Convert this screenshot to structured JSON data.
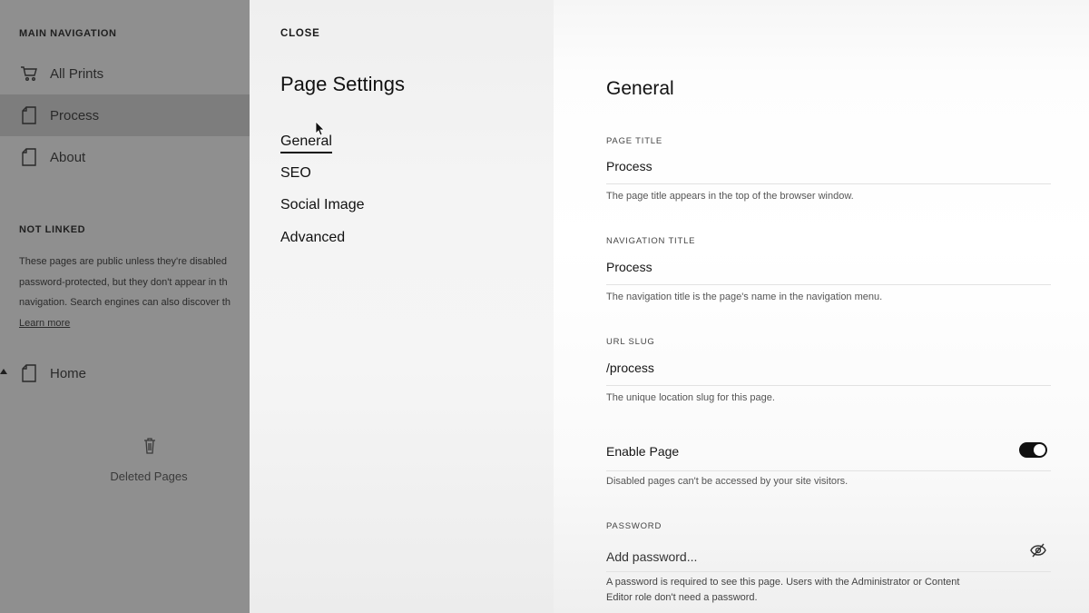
{
  "sidebar": {
    "main_nav_heading": "MAIN NAVIGATION",
    "items": [
      {
        "label": "All Prints",
        "icon": "cart-icon"
      },
      {
        "label": "Process",
        "icon": "page-icon"
      },
      {
        "label": "About",
        "icon": "page-icon"
      }
    ],
    "not_linked_heading": "NOT LINKED",
    "not_linked_note_lines": [
      "These pages are public unless they're disabled",
      "password-protected, but they don't appear in th",
      "navigation. Search engines can also discover th"
    ],
    "learn_more": "Learn more",
    "home_item": {
      "label": "Home",
      "icon": "page-icon"
    },
    "deleted_pages": "Deleted Pages"
  },
  "settings_menu": {
    "close_label": "CLOSE",
    "title": "Page Settings",
    "items": [
      "General",
      "SEO",
      "Social Image",
      "Advanced"
    ],
    "active_item": "General"
  },
  "general": {
    "title": "General",
    "page_title": {
      "label": "PAGE TITLE",
      "value": "Process",
      "help": "The page title appears in the top of the browser window."
    },
    "navigation_title": {
      "label": "NAVIGATION TITLE",
      "value": "Process",
      "help": "The navigation title is the page's name in the navigation menu."
    },
    "url_slug": {
      "label": "URL SLUG",
      "value": "/process",
      "help": "The unique location slug for this page."
    },
    "enable_page": {
      "label": "Enable Page",
      "enabled": true,
      "help": "Disabled pages can't be accessed by your site visitors."
    },
    "password": {
      "label": "PASSWORD",
      "placeholder": "Add password...",
      "help_lines": [
        "A password is required to see this page. Users with the Administrator or Content",
        "Editor role don't need a password."
      ]
    }
  },
  "colors": {
    "sidebar_bg": "#8f8f8f",
    "sidebar_active": "#7d7d7d",
    "toggle_on": "#111111"
  }
}
